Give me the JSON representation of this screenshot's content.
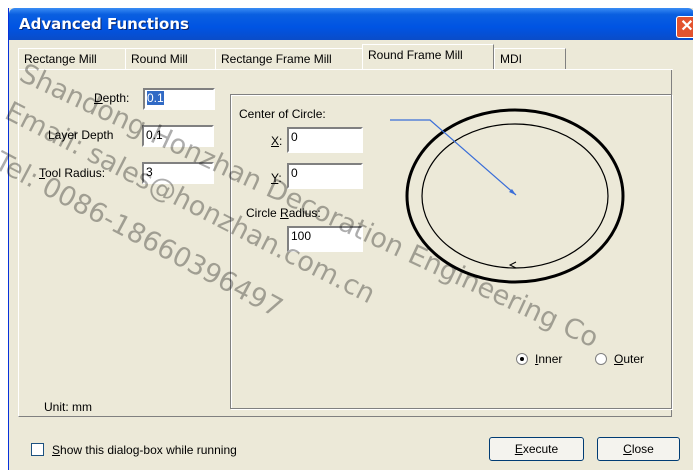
{
  "window": {
    "title": "Advanced Functions",
    "close_glyph": "✕"
  },
  "tabs": [
    {
      "label": "Rectange Mill",
      "active": false
    },
    {
      "label": "Round Mill",
      "active": false
    },
    {
      "label": "Rectange Frame Mill",
      "active": false
    },
    {
      "label": "Round Frame Mill",
      "active": true
    },
    {
      "label": "MDI",
      "active": false
    }
  ],
  "params": {
    "depth": {
      "label_underlined": "D",
      "label_rest": "epth:",
      "value": "0.1"
    },
    "layer_depth": {
      "label": "Layer Depth",
      "value": "0.1"
    },
    "tool_radius": {
      "label_underlined": "T",
      "label_rest": "ool Radius:",
      "value": "3"
    }
  },
  "center": {
    "heading": "Center of Circle:",
    "x": {
      "label_underlined": "X",
      "label_rest": ":",
      "value": "0"
    },
    "y": {
      "label_underlined": "Y",
      "label_rest": ":",
      "value": "0"
    },
    "radius": {
      "label_pre": "Circle ",
      "label_underlined": "R",
      "label_rest": "adius:",
      "value": "100"
    }
  },
  "mode": {
    "inner": {
      "label_underlined": "I",
      "label_rest": "nner",
      "selected": true
    },
    "outer": {
      "label_underlined": "O",
      "label_rest": "uter",
      "selected": false
    }
  },
  "unit": "Unit: mm",
  "show_dialog": {
    "label_underlined": "S",
    "label_rest": "how this dialog-box while running",
    "checked": false
  },
  "buttons": {
    "execute": {
      "label_underlined": "E",
      "label_rest": "xecute"
    },
    "close": {
      "label_underlined": "C",
      "label_rest": "lose"
    }
  },
  "watermark": {
    "line1": "Shandong Honzhan Decoration Engineering Co",
    "line2": "Email: sales@honzhan.com.cn",
    "line3": "Tel: 0086-18660396497"
  },
  "colors": {
    "title_bar": "#0054e3",
    "dialog_face": "#ece9d8",
    "close_button": "#e3532e",
    "selection": "#316ac5",
    "arrow": "#3a6ed8"
  }
}
